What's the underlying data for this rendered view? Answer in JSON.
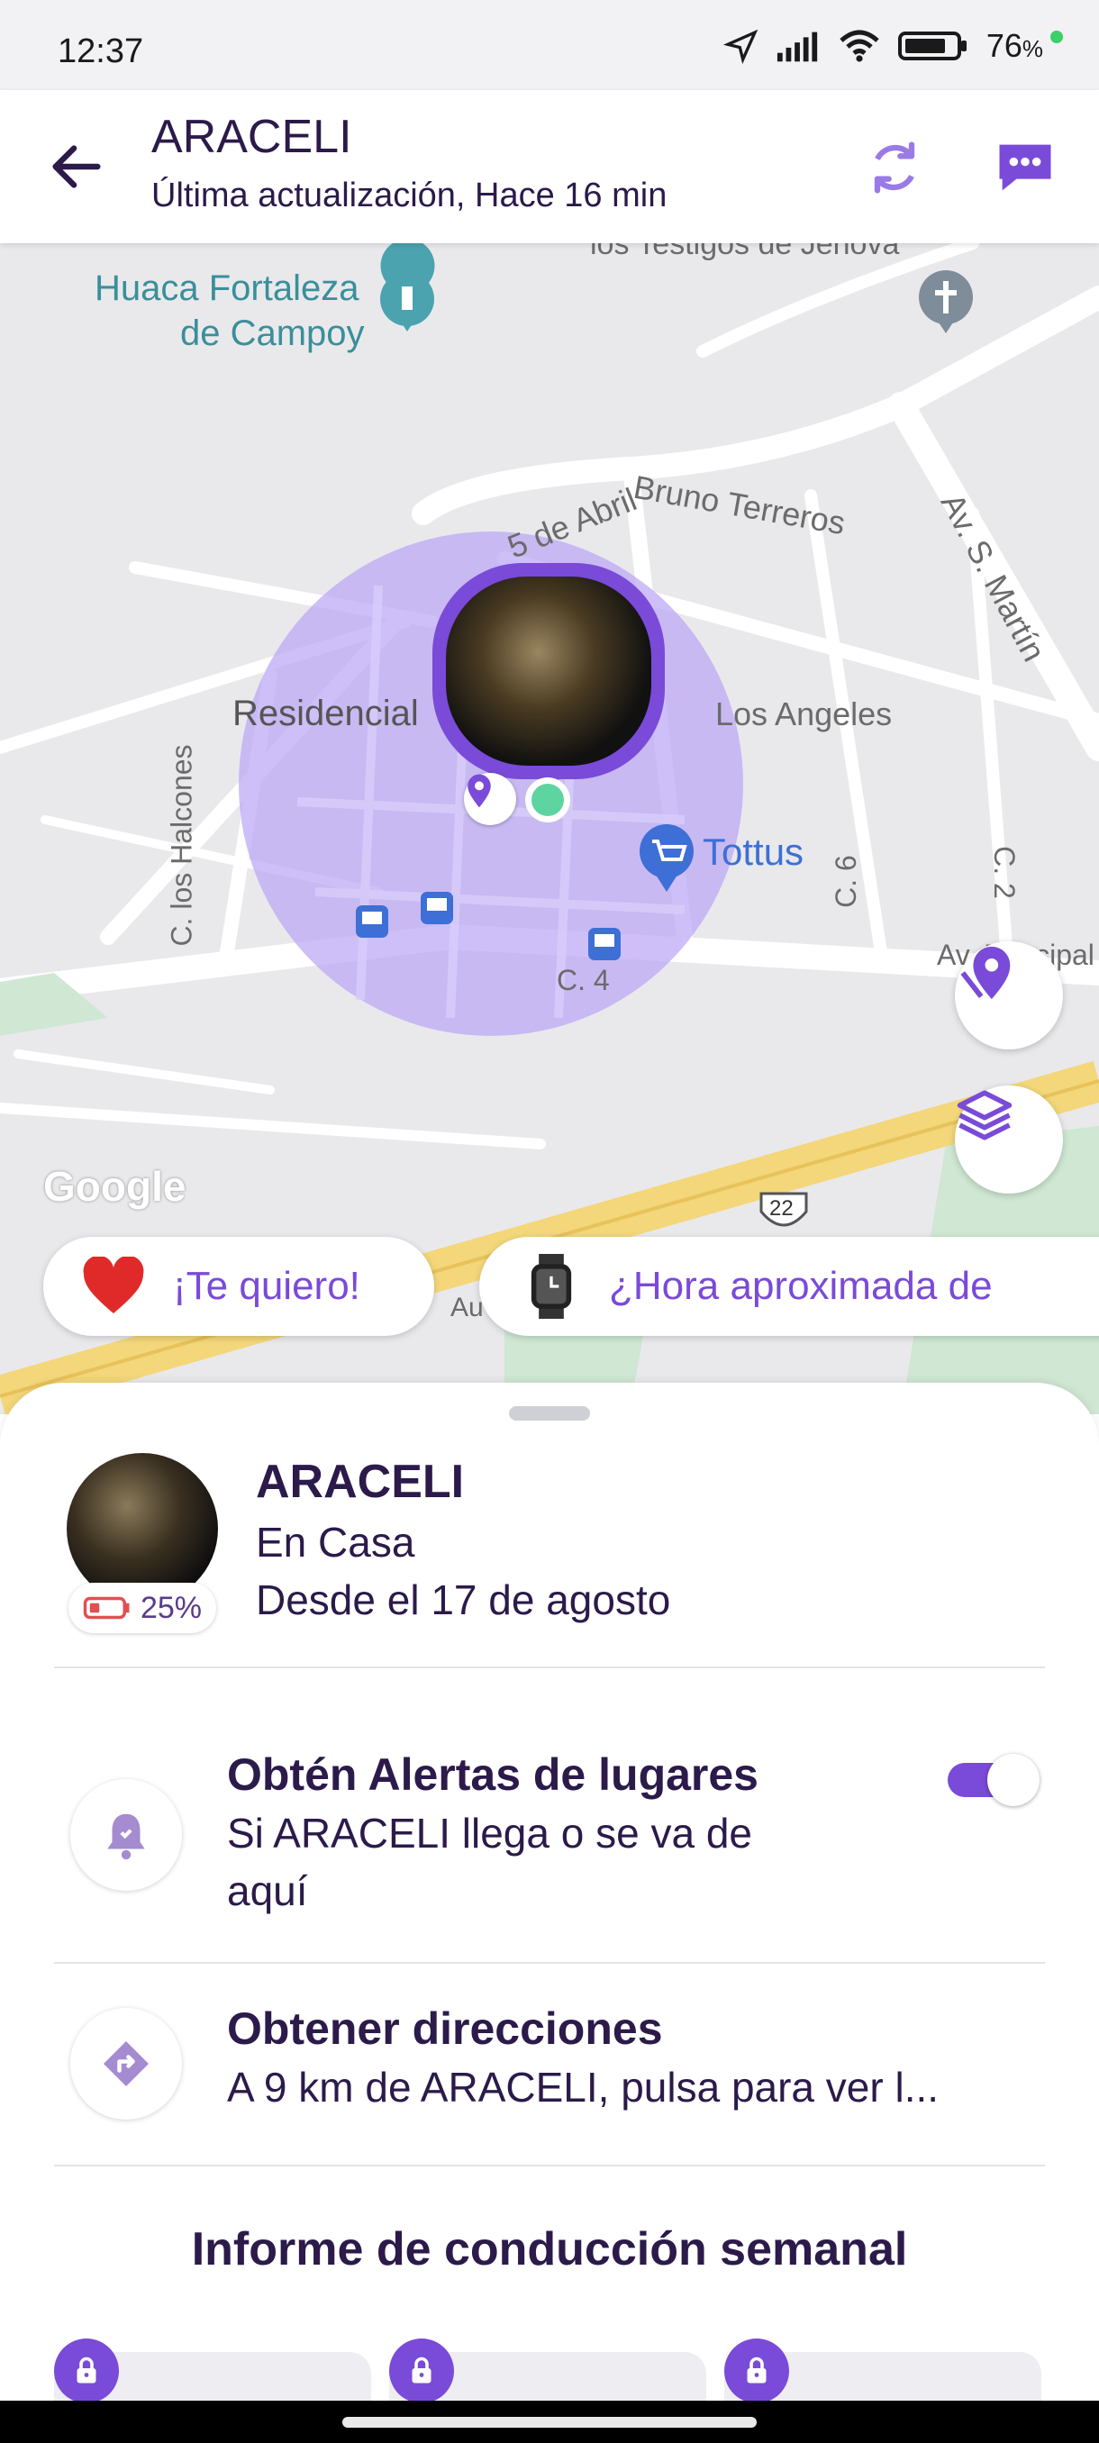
{
  "status_bar": {
    "time": "12:37",
    "battery_percent": "76",
    "battery_unit": "%"
  },
  "header": {
    "title": "ARACELI",
    "subtitle": "Última actualización, Hace 16 min"
  },
  "map": {
    "labels": {
      "huaca_1": "Huaca Fortaleza",
      "huaca_2": "de Campoy",
      "residencial": "Residencial",
      "los_angeles": "Los Angeles",
      "bruno": "Bruno Terreros",
      "cinco_abril": "5 de Abril",
      "av_san_martin": "Av. S. Martín",
      "los_halcones": "C. los Halcones",
      "c6": "C. 6",
      "c2": "C. 2",
      "c4": "C. 4",
      "tottus": "Tottus",
      "route": "22",
      "google": "Google",
      "testigos": "los Testigos de Jehová",
      "av_principal": "Av. Principal",
      "au": "Au"
    }
  },
  "chips": {
    "love": "¡Te quiero!",
    "eta": "¿Hora aproximada de"
  },
  "sheet": {
    "name": "ARACELI",
    "place": "En Casa",
    "since": "Desde el 17 de agosto",
    "battery": "25%",
    "alerts": {
      "title": "Obtén Alertas de lugares",
      "subtitle_line1": "Si ARACELI llega o se va de",
      "subtitle_line2": "aquí",
      "enabled": true
    },
    "directions": {
      "title": "Obtener direcciones",
      "subtitle": "A 9 km de ARACELI, pulsa para ver l..."
    },
    "report_title": "Informe de conducción semanal"
  },
  "colors": {
    "accent": "#7a4ad8",
    "zone": "#b9a4f5",
    "road_highway": "#f3d77a",
    "map_bg": "#e9e9ec"
  }
}
